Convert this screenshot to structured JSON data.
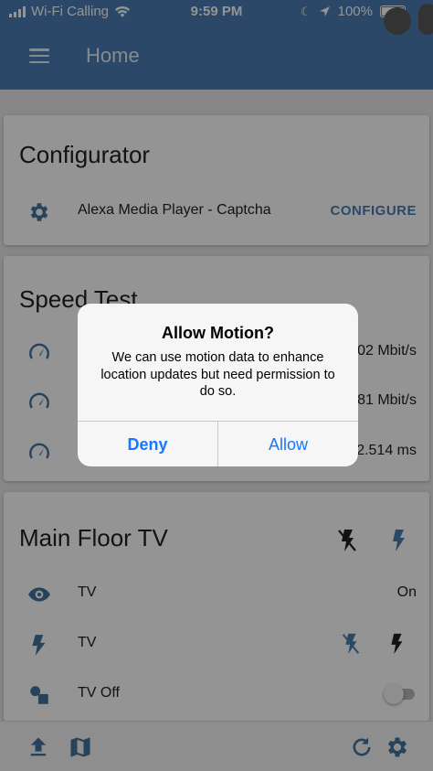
{
  "status_bar": {
    "carrier": "Wi-Fi Calling",
    "time": "9:59 PM",
    "battery": "100%"
  },
  "header": {
    "title": "Home"
  },
  "configurator": {
    "title": "Configurator",
    "rows": [
      {
        "label": "Alexa Media Player - Captcha",
        "action": "CONFIGURE"
      }
    ]
  },
  "speed_test": {
    "title": "Speed Test",
    "values": [
      "02 Mbit/s",
      "81 Mbit/s",
      "2.514 ms"
    ]
  },
  "main_floor_tv": {
    "title": "Main Floor TV",
    "rows": [
      {
        "label": "TV",
        "value": "On"
      },
      {
        "label": "TV"
      },
      {
        "label": "TV Off"
      }
    ]
  },
  "dialog": {
    "title": "Allow Motion?",
    "message": "We can use motion data to enhance location updates but need permission to do so.",
    "deny_label": "Deny",
    "allow_label": "Allow"
  },
  "colors": {
    "primary": "#4a7db5",
    "ios_blue": "#1677ff",
    "icon": "#44739e"
  }
}
